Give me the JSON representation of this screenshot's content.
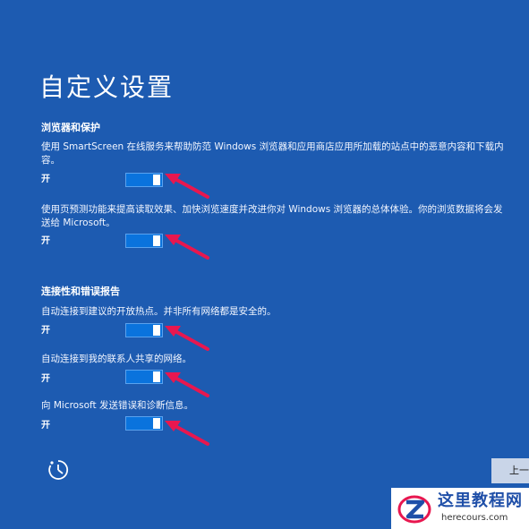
{
  "page_title": "自定义设置",
  "sections": [
    {
      "heading": "浏览器和保护",
      "settings": [
        {
          "desc": "使用 SmartScreen 在线服务来帮助防范 Windows 浏览器和应用商店应用所加载的站点中的恶意内容和下载内容。",
          "state": "开",
          "on": true
        },
        {
          "desc": "使用页预测功能来提高读取效果、加快浏览速度并改进你对 Windows 浏览器的总体体验。你的浏览数据将会发送给 Microsoft。",
          "state": "开",
          "on": true
        }
      ]
    },
    {
      "heading": "连接性和错误报告",
      "settings": [
        {
          "desc": "自动连接到建议的开放热点。并非所有网络都是安全的。",
          "state": "开",
          "on": true
        },
        {
          "desc": "自动连接到我的联系人共享的网络。",
          "state": "开",
          "on": true
        },
        {
          "desc": "向 Microsoft 发送错误和诊断信息。",
          "state": "开",
          "on": true
        }
      ]
    }
  ],
  "footer": {
    "accessibility_icon": "ease-of-access-icon",
    "back_label": "上一"
  },
  "annotation": {
    "arrow_icon": "red-pointer-arrow-icon",
    "arrow_color": "#e8174f"
  },
  "watermark": {
    "name": "这里教程网",
    "url": "herecours.com",
    "logo_icon": "z-logo-icon"
  },
  "colors": {
    "background": "#1d5bb1",
    "toggle_on": "#0a73dd",
    "text": "#ffffff"
  }
}
